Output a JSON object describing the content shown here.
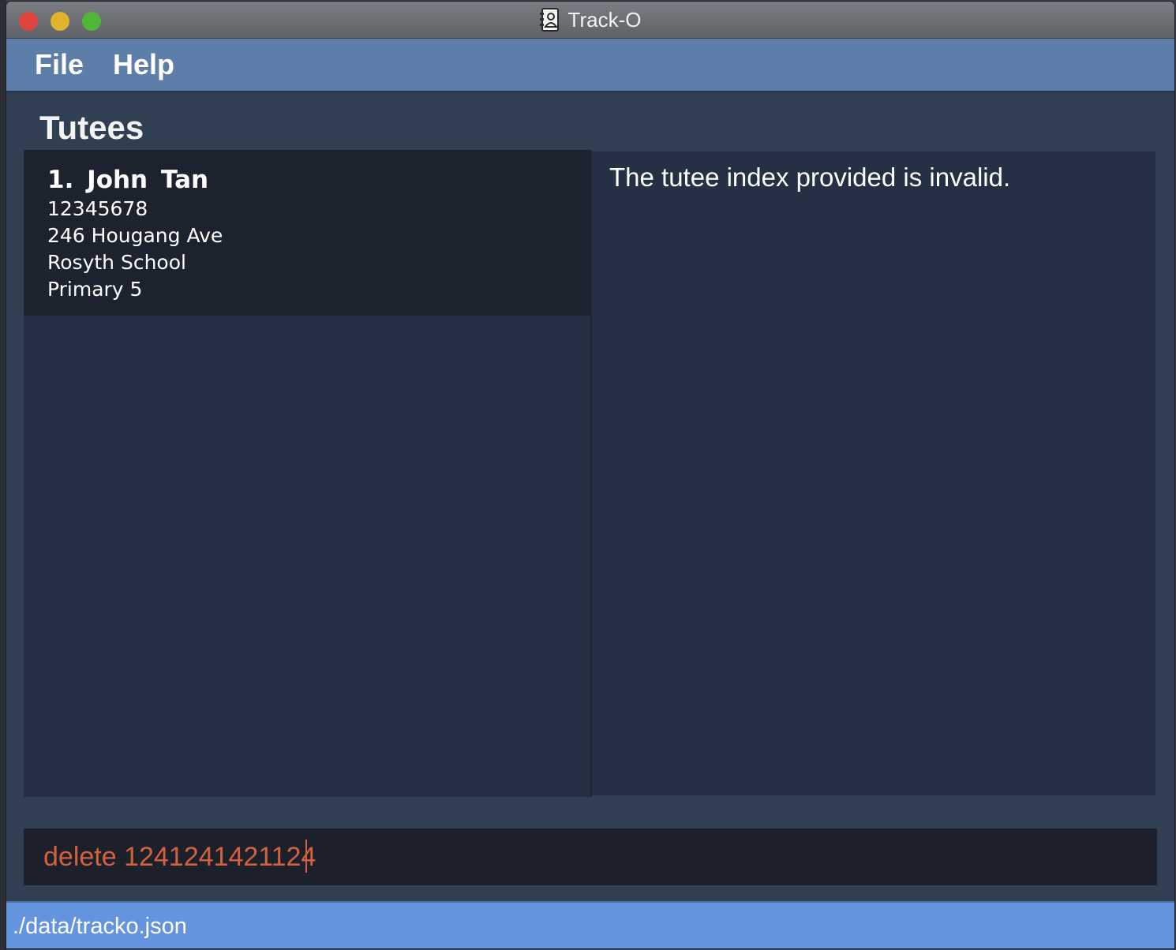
{
  "window": {
    "title": "Track-O"
  },
  "menu": {
    "file_label": "File",
    "help_label": "Help"
  },
  "list": {
    "heading": "Tutees",
    "tutees": [
      {
        "index": "1.",
        "name": "John Tan",
        "phone": "12345678",
        "address": "246 Hougang Ave",
        "school": "Rosyth School",
        "level": "Primary 5"
      }
    ]
  },
  "result": {
    "message": "The tutee index provided is invalid."
  },
  "command": {
    "value": "delete 1241241421124"
  },
  "status": {
    "file_path": "./data/tracko.json"
  },
  "colors": {
    "menubar": "#5d7ea8",
    "background": "#313f53",
    "panel": "#253044",
    "card": "#1c222e",
    "command_text_error": "#d5603e",
    "statusbar": "#6594de"
  },
  "icons": {
    "title_icon": "contacts-book-icon"
  }
}
